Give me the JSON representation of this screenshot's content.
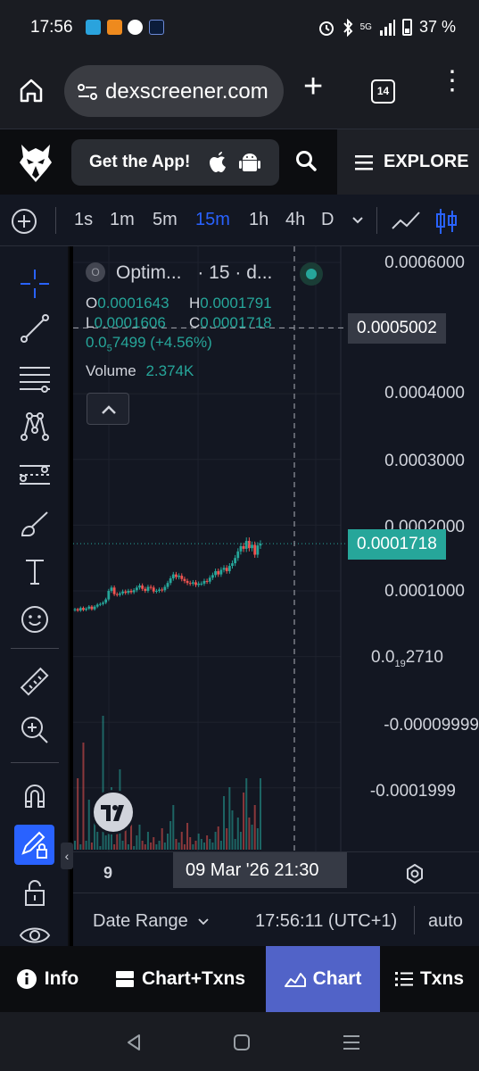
{
  "status_bar": {
    "time": "17:56",
    "network": "5G",
    "battery": "37 %"
  },
  "browser": {
    "url": "dexscreener.com",
    "tab_count": "14"
  },
  "header": {
    "get_app_label": "Get the App!",
    "explore_label": "EXPLORE"
  },
  "timeframes": {
    "items": [
      "1s",
      "1m",
      "5m",
      "15m",
      "1h",
      "4h",
      "D"
    ],
    "active": "15m"
  },
  "legend": {
    "symbol_badge": "O",
    "pair": "Optim...",
    "interval": "· 15 · d...",
    "open_key": "O",
    "open_val": "0.0001643",
    "high_key": "H",
    "high_val": "0.0001791",
    "low_key": "L",
    "low_val": "0.0001606",
    "close_key": "C",
    "close_val": "0.0001718",
    "change_prefix": "0.0",
    "change_sub": "5",
    "change_rest": "7499 (+4.56%)",
    "volume_key": "Volume",
    "volume_val": "2.374K"
  },
  "price_axis": {
    "labels": [
      "0.0006000",
      "0.0004000",
      "0.0003000",
      "0.0002000",
      "0.0001000",
      "-0.00009999",
      "-0.0001999"
    ],
    "zero_prefix": "0.0",
    "zero_sub": "19",
    "zero_rest": "2710",
    "crosshair_price": "0.0005002",
    "last_price": "0.0001718"
  },
  "time_axis": {
    "day_label": "9",
    "crosshair_time": "09 Mar '26   21:30"
  },
  "bottom_toolbar": {
    "date_range": "Date Range",
    "clock": "17:56:11 (UTC+1)",
    "scale": "auto"
  },
  "bottom_tabs": {
    "info": "Info",
    "chart_txns": "Chart+Txns",
    "chart": "Chart",
    "txns": "Txns"
  },
  "colors": {
    "up": "#26a69a",
    "down": "#ef5350",
    "accent": "#2962ff",
    "active_tab": "#5163c8"
  },
  "chart_data": {
    "type": "candlestick",
    "interval": "15m",
    "last_close": 0.0001718,
    "candles_close": [
      7.2e-05,
      7e-05,
      7.4e-05,
      7.1e-05,
      7.3e-05,
      7.6e-05,
      7.2e-05,
      7.6e-05,
      7.9e-05,
      8e-05,
      8.2e-05,
      8.7e-05,
      0.0001,
      0.000105,
      9.5e-05,
      9.4e-05,
      9.6e-05,
      9.9e-05,
      9.7e-05,
      0.0001,
      9.8e-05,
      0.000101,
      0.000105,
      0.000108,
      0.000103,
      0.0001,
      0.000106,
      0.000105,
      9.9e-05,
      0.0001,
      0.000102,
      0.000101,
      0.000106,
      0.000112,
      0.000119,
      0.000125,
      0.000121,
      0.000123,
      0.000118,
      0.000115,
      0.000112,
      0.000111,
      0.000113,
      0.000109,
      0.000111,
      0.000111,
      0.000115,
      0.000114,
      0.00012,
      0.000124,
      0.00013,
      0.000125,
      0.000132,
      0.000135,
      0.00013,
      0.000138,
      0.000142,
      0.00015,
      0.00016,
      0.000168,
      0.000164,
      0.000176,
      0.000165,
      0.00017,
      0.000155,
      0.000169,
      0.0001718
    ],
    "volume": [
      0.05,
      0.4,
      0.03,
      0.6,
      0.05,
      0.28,
      0.04,
      0.25,
      0.1,
      0.02,
      0.75,
      0.08,
      0.2,
      0.35,
      0.03,
      0.12,
      0.45,
      0.05,
      0.18,
      0.03,
      0.22,
      0.02,
      0.08,
      0.14,
      0.05,
      0.03,
      0.1,
      0.04,
      0.07,
      0.03,
      0.05,
      0.12,
      0.04,
      0.09,
      0.16,
      0.25,
      0.06,
      0.04,
      0.1,
      0.03,
      0.15,
      0.07,
      0.03,
      0.05,
      0.09,
      0.06,
      0.04,
      0.08,
      0.06,
      0.04,
      0.1,
      0.13,
      0.05,
      0.3,
      0.12,
      0.35,
      0.22,
      0.06,
      0.18,
      0.1,
      0.32,
      0.4,
      0.18,
      0.14,
      0.25,
      0.12,
      0.4
    ],
    "ylim": [
      -0.00025,
      0.00062
    ]
  }
}
